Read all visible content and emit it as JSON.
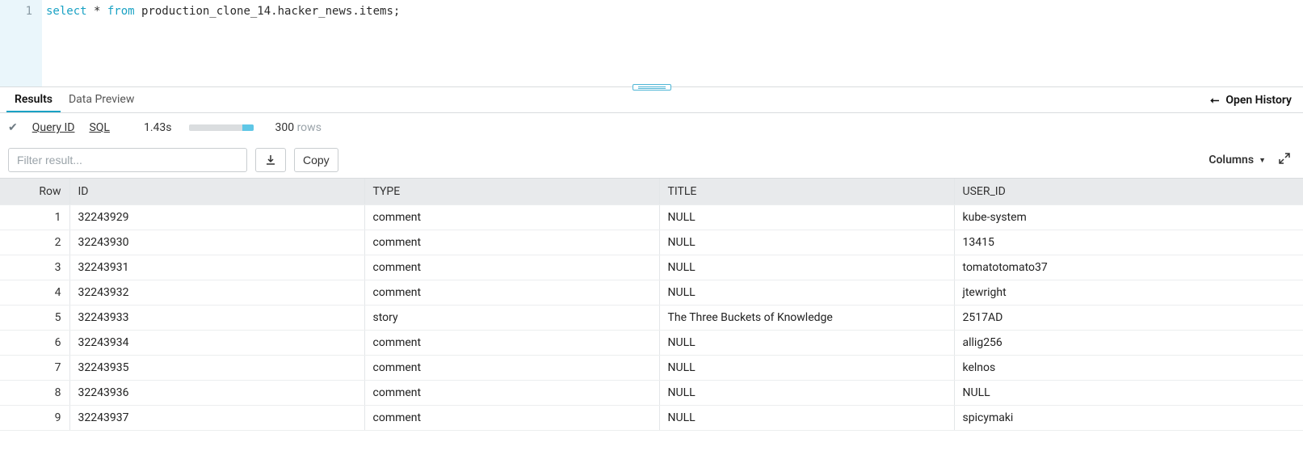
{
  "editor": {
    "gutter_line": "1",
    "sql_select": "select",
    "sql_star": " * ",
    "sql_from": "from",
    "sql_rest": " production_clone_14.hacker_news.items;"
  },
  "tabs": {
    "results": "Results",
    "data_preview": "Data Preview",
    "open_history": "Open History"
  },
  "status": {
    "query_id_label": "Query ID",
    "sql_label": "SQL",
    "time": "1.43s",
    "rows_count": "300",
    "rows_word": "rows"
  },
  "toolbar": {
    "filter_placeholder": "Filter result...",
    "copy_label": "Copy",
    "columns_label": "Columns",
    "columns_caret": "▼"
  },
  "table": {
    "headers": {
      "row": "Row",
      "id": "ID",
      "type": "TYPE",
      "title": "TITLE",
      "user": "USER_ID"
    },
    "rows": [
      {
        "n": "1",
        "id": "32243929",
        "type": "comment",
        "title": "NULL",
        "user": "kube-system"
      },
      {
        "n": "2",
        "id": "32243930",
        "type": "comment",
        "title": "NULL",
        "user": "13415"
      },
      {
        "n": "3",
        "id": "32243931",
        "type": "comment",
        "title": "NULL",
        "user": "tomatotomato37"
      },
      {
        "n": "4",
        "id": "32243932",
        "type": "comment",
        "title": "NULL",
        "user": "jtewright"
      },
      {
        "n": "5",
        "id": "32243933",
        "type": "story",
        "title": "The Three Buckets of Knowledge",
        "user": "2517AD"
      },
      {
        "n": "6",
        "id": "32243934",
        "type": "comment",
        "title": "NULL",
        "user": "allig256"
      },
      {
        "n": "7",
        "id": "32243935",
        "type": "comment",
        "title": "NULL",
        "user": "kelnos"
      },
      {
        "n": "8",
        "id": "32243936",
        "type": "comment",
        "title": "NULL",
        "user": "NULL"
      },
      {
        "n": "9",
        "id": "32243937",
        "type": "comment",
        "title": "NULL",
        "user": "spicymaki"
      }
    ]
  }
}
